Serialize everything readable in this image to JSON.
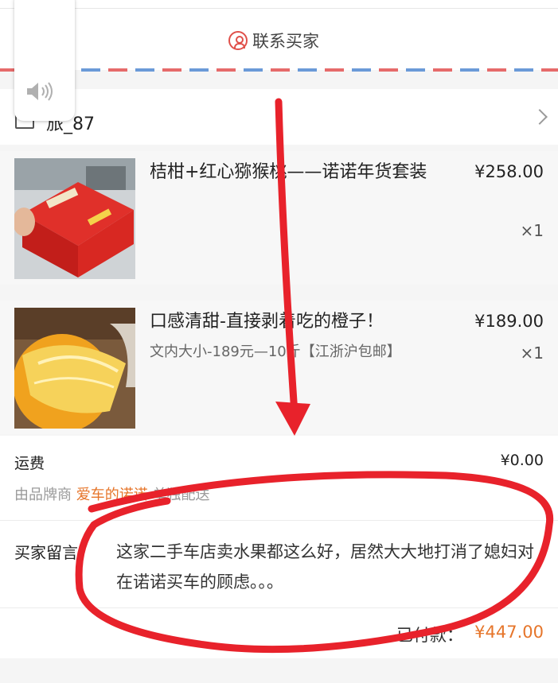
{
  "contact": {
    "label": "联系买家",
    "icon": "person-icon"
  },
  "store": {
    "name": "旅_87",
    "icon": "store-icon"
  },
  "items": [
    {
      "name": "桔柑+红心猕猴桃——诺诺年货套装",
      "price": "¥258.00",
      "quantity": "×1"
    },
    {
      "name": "口感清甜-直接剥着吃的橙子！",
      "spec": "文内大小-189元—10斤【江浙沪包邮】",
      "price": "¥189.00",
      "quantity": "×1"
    }
  ],
  "shipping": {
    "label": "运费",
    "value": "¥0.00",
    "note_prefix": "由品牌商 ",
    "brand": "爱车的诺诺",
    "note_suffix": " 单独配送"
  },
  "message": {
    "label": "买家留言：",
    "text": "这家二手车店卖水果都这么好，居然大大地打消了媳妇对在诺诺买车的顾虑。。。"
  },
  "total": {
    "label": "已付款：",
    "value": "¥447.00"
  },
  "colors": {
    "accent": "#e6752a",
    "annotation": "#e8222b",
    "airmail_red": "#e66a6a",
    "airmail_blue": "#6a9ad8"
  }
}
